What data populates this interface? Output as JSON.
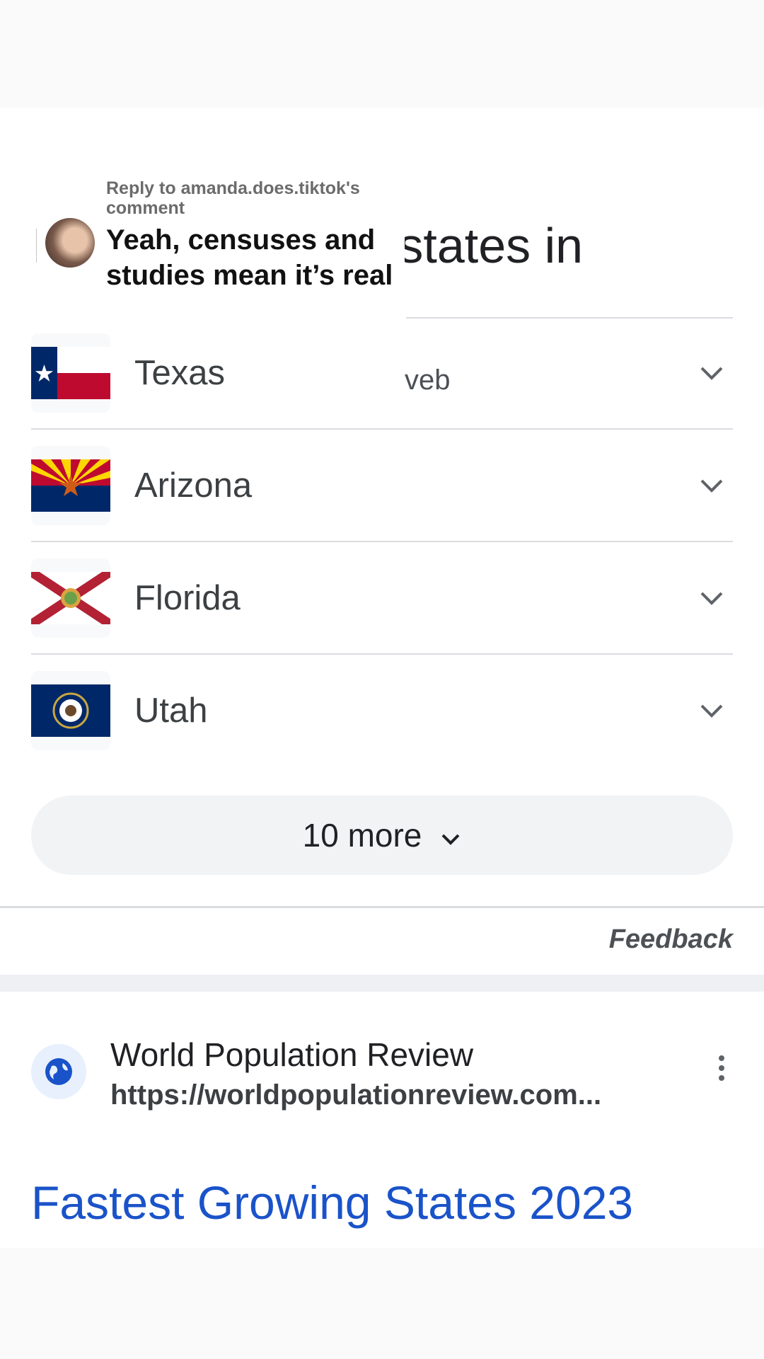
{
  "heading": "Fastest-growing states in",
  "source_fragment": "veb",
  "states": [
    {
      "name": "Texas",
      "flag": "texas-flag-icon"
    },
    {
      "name": "Arizona",
      "flag": "arizona-flag-icon"
    },
    {
      "name": "Florida",
      "flag": "florida-flag-icon"
    },
    {
      "name": "Utah",
      "flag": "utah-flag-icon"
    }
  ],
  "more_button": {
    "label": "10 more",
    "icon": "chevron-down-icon"
  },
  "feedback": "Feedback",
  "result": {
    "site_name": "World Population Review",
    "url": "https://worldpopulationreview.com...",
    "title": "Fastest Growing States 2023",
    "site_icon": "globe-icon",
    "menu_icon": "more-vertical-icon"
  },
  "reply_overlay": {
    "reply_to": "Reply to amanda.does.tiktok's comment",
    "text": "Yeah, censuses and studies mean it’s real"
  },
  "colors": {
    "link_blue": "#1a53c9",
    "divider": "#dadce0",
    "button_bg": "#f1f3f4"
  }
}
